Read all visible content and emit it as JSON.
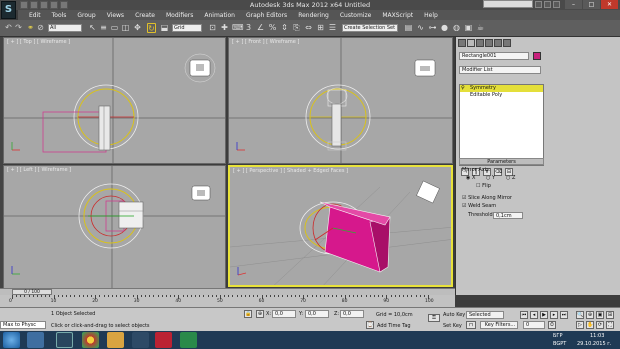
{
  "window": {
    "title": "Autodesk 3ds Max  2012 x64        Untitled",
    "search_placeholder": "Type a keyword or phrase"
  },
  "menu": [
    "Edit",
    "Tools",
    "Group",
    "Views",
    "Create",
    "Modifiers",
    "Animation",
    "Graph Editors",
    "Rendering",
    "Customize",
    "MAXScript",
    "Help"
  ],
  "toolbar": {
    "filter": "All",
    "refcoord": "Grid",
    "selection_set": "Create Selection Set"
  },
  "viewports": {
    "top": "[ + ] [ Top ] [ Wireframe ]",
    "front": "[ + ] [ Front ] [ Wireframe ]",
    "left": "[ + ] [ Left ] [ Wireframe ]",
    "perspective": "[ + ] [ Perspective ] [ Shaded + Edged Faces ]"
  },
  "command_panel": {
    "object_name": "Rectangle001",
    "modifier_list": "Modifier List",
    "stack": [
      "Symmetry",
      "Editable Poly"
    ],
    "rollout": "Parameters",
    "mirror_axis_label": "Mirror Axis:",
    "axes": [
      "X",
      "Y",
      "Z"
    ],
    "flip": "Flip",
    "slice": "Slice Along Mirror",
    "weld": "Weld Seam",
    "threshold_label": "Threshold:",
    "threshold_value": "0,1cm"
  },
  "timeline": {
    "frame": "0 / 100",
    "ticks": [
      "0",
      "10",
      "20",
      "30",
      "40",
      "50",
      "60",
      "70",
      "80",
      "90",
      "100"
    ]
  },
  "status": {
    "script_box": "Max to Physc",
    "selected": "1 Object Selected",
    "prompt": "Click or click-and-drag to select objects",
    "x": "0,0",
    "y": "0,0",
    "z": "0,0",
    "grid": "Grid = 10,0cm",
    "add_time_tag": "Add Time Tag",
    "auto_key": "Auto Key",
    "set_key": "Set Key",
    "key_mode": "Selected",
    "key_filters": "Key Filters...",
    "frame_field": "0"
  },
  "taskbar": {
    "lang": "БГР",
    "lang2": "BGPT",
    "time": "11:03",
    "date": "29.10.2015 г."
  },
  "colors": {
    "accent_yellow": "#e8e23a",
    "object_magenta": "#d6188c",
    "selection_white": "#ffffff"
  }
}
